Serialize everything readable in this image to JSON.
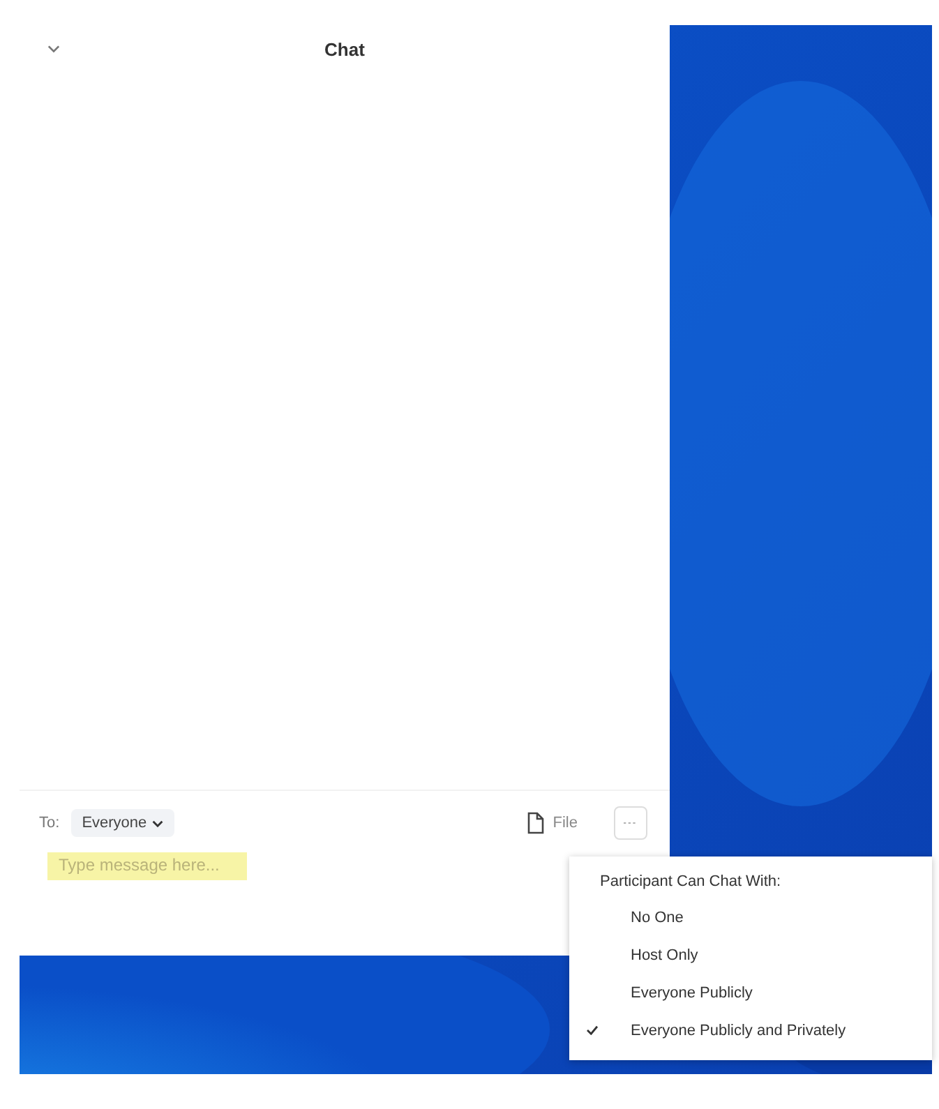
{
  "chat": {
    "title": "Chat",
    "recipient_label": "To:",
    "recipient": "Everyone",
    "file_button": "File",
    "message": {
      "placeholder": "Type message here..."
    }
  },
  "menu": {
    "heading": "Participant Can Chat With:",
    "items": [
      {
        "label": "No One",
        "selected": false
      },
      {
        "label": "Host Only",
        "selected": false
      },
      {
        "label": "Everyone Publicly",
        "selected": false
      },
      {
        "label": "Everyone Publicly and Privately",
        "selected": true
      }
    ]
  }
}
